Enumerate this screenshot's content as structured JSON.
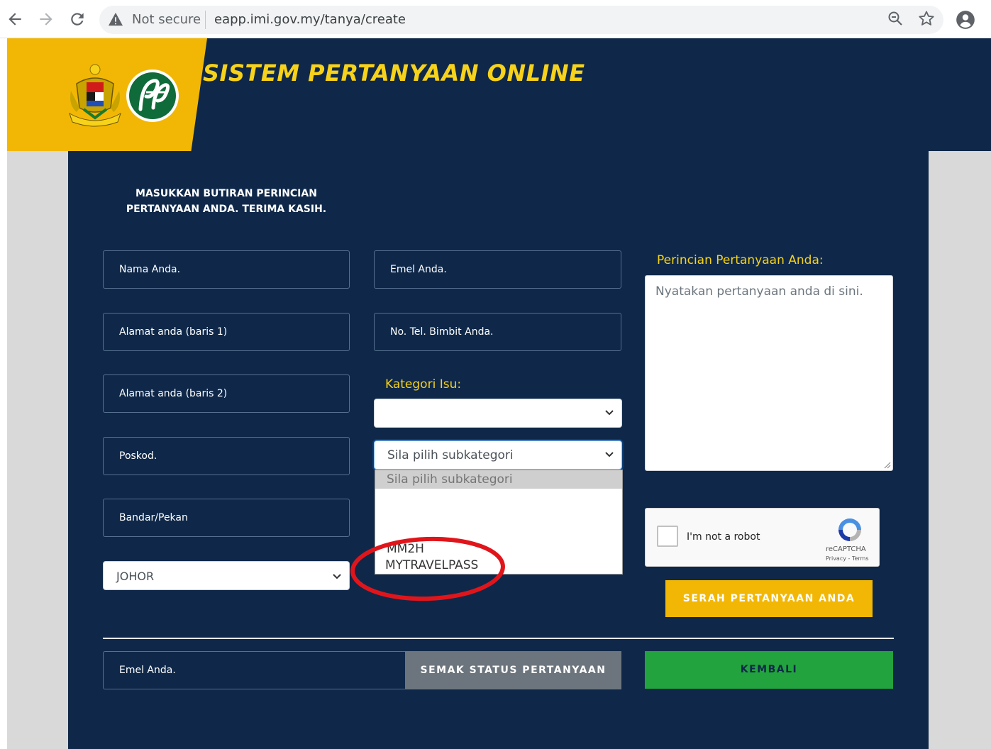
{
  "browser": {
    "security_label": "Not secure",
    "url": "eapp.imi.gov.my/tanya/create"
  },
  "header": {
    "title": "SISTEM PERTANYAAN ONLINE"
  },
  "form": {
    "instructions": "MASUKKAN BUTIRAN PERINCIAN PERTANYAAN ANDA. TERIMA KASIH.",
    "name_placeholder": "Nama Anda.",
    "address1_placeholder": "Alamat anda (baris 1)",
    "address2_placeholder": "Alamat anda (baris 2)",
    "postcode_placeholder": "Poskod.",
    "city_placeholder": "Bandar/Pekan",
    "state_value": "JOHOR",
    "email_placeholder": "Emel Anda.",
    "phone_placeholder": "No. Tel. Bimbit Anda.",
    "category_label": "Kategori Isu:",
    "category_value": "",
    "subcategory_value": "Sila pilih subkategori",
    "subcategory_options": [
      "Sila pilih subkategori",
      "MM2H",
      "MYTRAVELPASS"
    ],
    "details_label": "Perincian Pertanyaan Anda:",
    "details_placeholder": "Nyatakan pertanyaan anda di sini.",
    "recaptcha_label": "I'm not a robot",
    "recaptcha_brand": "reCAPTCHA",
    "recaptcha_links": "Privacy - Terms",
    "submit_label": "SERAH PERTANYAAN ANDA"
  },
  "status": {
    "email_placeholder": "Emel Anda.",
    "check_label": "SEMAK STATUS PERTANYAAN",
    "back_label": "KEMBALI"
  },
  "colors": {
    "navy": "#0f2849",
    "yellow": "#f2b705",
    "green": "#22a33e",
    "annotation_red": "#e0151b"
  }
}
